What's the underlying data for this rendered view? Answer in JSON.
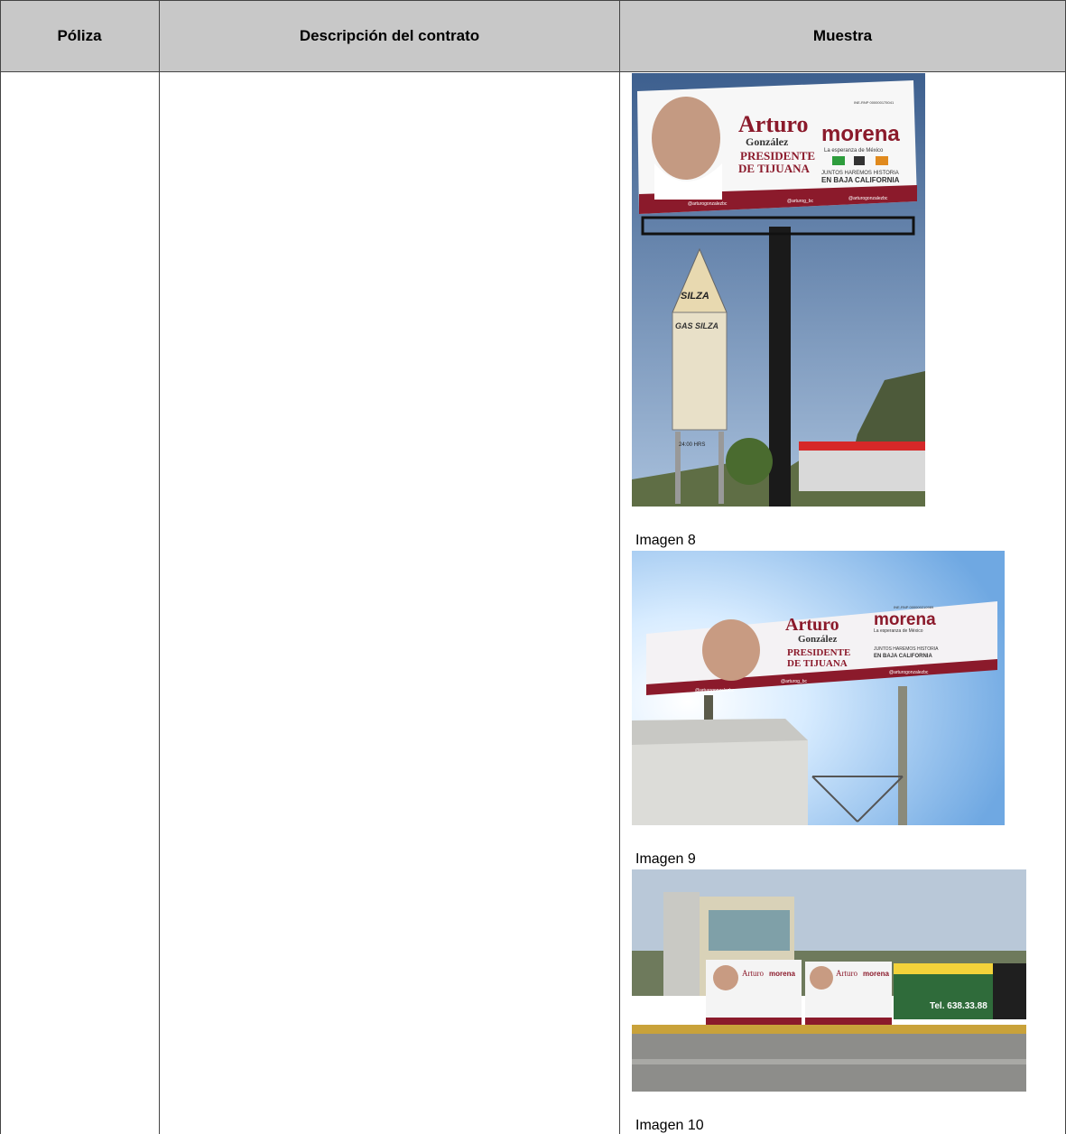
{
  "table": {
    "headers": {
      "poliza": "Póliza",
      "descripcion": "Descripción del contrato",
      "muestra": "Muestra"
    }
  },
  "billboard": {
    "name_first": "Arturo",
    "name_last": "González",
    "office_line1": "PRESIDENTE",
    "office_line2": "DE TIJUANA",
    "party": "morena",
    "party_tagline": "La esperanza de México",
    "slogan_line1": "JUNTOS HAREMOS HISTORIA",
    "slogan_line2": "EN BAJA CALIFORNIA",
    "social_facebook": "@arturogonzalezbc",
    "social_twitter": "@arturog_bc",
    "social_instagram": "@arturogonzalezbc",
    "ine_code": "INE-RNP 000000175041",
    "ine_code_2": "INE-RNP 000000210989"
  },
  "gas_sign": {
    "brand": "SILZA",
    "brand_2": "GAS SILZA",
    "hours": "24:00 HRS"
  },
  "street_sign": {
    "text": "Tel. 638.33.88"
  },
  "captions": {
    "img8": "Imagen 8",
    "img9": "Imagen 9",
    "img10": "Imagen 10"
  },
  "colors": {
    "header_bg": "#c8c8c8",
    "morena": "#8b1a2b",
    "sky": "#8fb3d9"
  }
}
